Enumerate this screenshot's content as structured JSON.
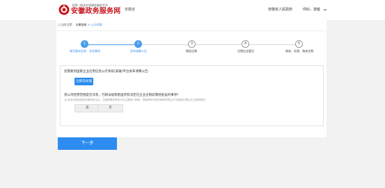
{
  "header": {
    "brand_small": "全国一体化在线政务服务平台",
    "brand_main": "安徽政务服务网",
    "region": "安徽省",
    "gov_link": "安徽省人民政府",
    "greeting": "你好，游客"
  },
  "breadcrumb": {
    "prefix": "当前位置：",
    "items": [
      "办事指南",
      "公示时限"
    ],
    "separator": " > "
  },
  "steps": [
    {
      "number": "1",
      "label": "填写基本信息、业务事项",
      "state": "active"
    },
    {
      "number": "2",
      "label": "发布清算公告",
      "state": "active"
    },
    {
      "number": "3",
      "label": "税务注销",
      "state": "todo"
    },
    {
      "number": "4",
      "label": "注销企业登记",
      "state": "todo"
    },
    {
      "number": "5",
      "label": "商务、社保、海关注销",
      "state": "todo"
    }
  ],
  "question1": {
    "text": "您需要到国家企业信用信息公示系统(安徽)平台发布清算公告:",
    "button": "立即去办理"
  },
  "question2": {
    "text": "贵公司经营范围是否涉及，行政法规或者国务院决定在企业注销前需经批准的事项?",
    "note": "注:对涉及须经批准的事项的企业，注销前需经有关行业主管部门审批，须取得有关机构审核同意后方可继续办理企业注销的情况。",
    "yes": "是",
    "no": "否"
  },
  "next_button": "下一步",
  "colors": {
    "brand_red": "#c8161e",
    "primary_blue": "#2d8cf0",
    "step_active": "#4a9de8"
  }
}
